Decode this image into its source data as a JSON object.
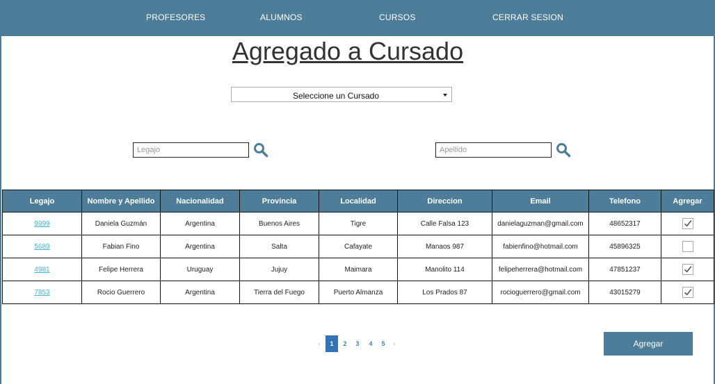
{
  "nav": {
    "items": [
      "PROFESORES",
      "ALUMNOS",
      "CURSOS",
      "CERRAR SESION"
    ]
  },
  "page": {
    "title": "Agregado a Cursado"
  },
  "cursado_select": {
    "selected": "Seleccione un Cursado"
  },
  "search": {
    "legajo_placeholder": "Legajo",
    "apellido_placeholder": "Apellido",
    "icon": "search-icon"
  },
  "table": {
    "headers": [
      "Legajo",
      "Nombre y Apellido",
      "Nacionalidad",
      "Provincia",
      "Localidad",
      "Direccion",
      "Email",
      "Telefono",
      "Agregar"
    ],
    "rows": [
      {
        "legajo": "9999",
        "nombre": "Daniela Guzmán",
        "nacionalidad": "Argentina",
        "provincia": "Buenos Aires",
        "localidad": "Tigre",
        "direccion": "Calle Falsa 123",
        "email": "danielaguzman@gmail.com",
        "telefono": "48652317",
        "agregar": true
      },
      {
        "legajo": "5689",
        "nombre": "Fabian Fino",
        "nacionalidad": "Argentina",
        "provincia": "Salta",
        "localidad": "Cafayate",
        "direccion": "Manaos 987",
        "email": "fabienfino@hotmail.com",
        "telefono": "45896325",
        "agregar": false
      },
      {
        "legajo": "4981",
        "nombre": "Felipe Herrera",
        "nacionalidad": "Uruguay",
        "provincia": "Jujuy",
        "localidad": "Maimara",
        "direccion": "Manolito 114",
        "email": "felipeherrera@hotmail.com",
        "telefono": "47851237",
        "agregar": true
      },
      {
        "legajo": "7853",
        "nombre": "Rocio Guerrero",
        "nacionalidad": "Argentina",
        "provincia": "Tierra del Fuego",
        "localidad": "Puerto Almanza",
        "direccion": "Los Prados 87",
        "email": "rocioguerrero@gmail.com",
        "telefono": "43015279",
        "agregar": true
      }
    ]
  },
  "pagination": {
    "prev": "‹",
    "pages": [
      "1",
      "2",
      "3",
      "4",
      "5"
    ],
    "active": "1",
    "next": "›"
  },
  "actions": {
    "agregar_label": "Agregar"
  },
  "colors": {
    "primary": "#4e7d99",
    "link": "#41b5d8",
    "page_active": "#3273b5"
  }
}
